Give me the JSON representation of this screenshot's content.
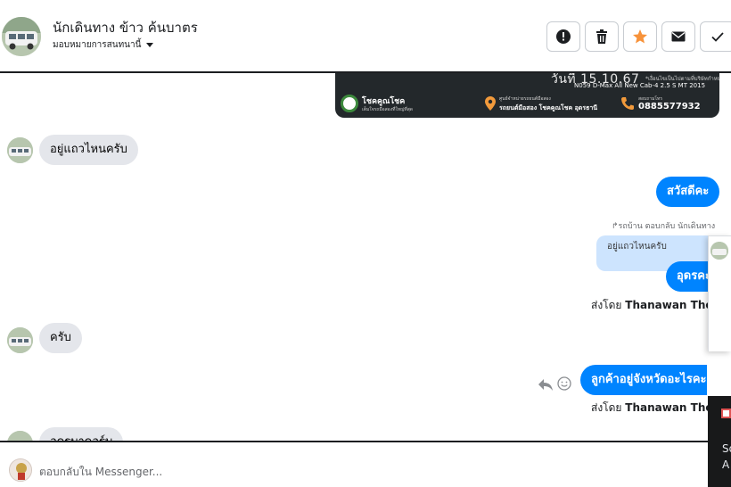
{
  "header": {
    "contact_name": "นักเดินทาง ข้าว ค้นบาตร",
    "assign_label": "มอบหมายการสนทนานี้",
    "actions": [
      {
        "name": "report-button",
        "icon": "alert-icon"
      },
      {
        "name": "delete-button",
        "icon": "trash-icon"
      },
      {
        "name": "star-button",
        "icon": "star-icon"
      },
      {
        "name": "mark-unread-button",
        "icon": "envelope-icon"
      },
      {
        "name": "mark-done-button",
        "icon": "check-icon"
      }
    ]
  },
  "banner": {
    "date": "วันที่ 15.10.67",
    "note": "*เงื่อนไขเป็นไปตามที่บริษัทกำหนด",
    "model": "N059 D-Max All New Cab-4 2.5 S MT 2015",
    "brand": "โชคคูณโชค",
    "brand_sub": "เต็มใจรถมือสองที่ใหญ่ที่สุด",
    "address_title": "ศูนย์จำหน่ายรถยนต์มือสอง",
    "address": "รถยนต์มือสอง โชคคูณโชค อุดรธานี",
    "phone_title": "สอบถามโทร",
    "phone": "0885577932"
  },
  "messages": [
    {
      "dir": "in",
      "text": "อยู่แถวไหนครับ"
    },
    {
      "dir": "out",
      "text": "สวัสดีคะ"
    },
    {
      "dir": "reply_label",
      "text": "รถบ้าน ตอบกลับ นักเดินทาง"
    },
    {
      "dir": "quote",
      "text": "อยู่แถวไหนครับ"
    },
    {
      "dir": "out",
      "text": "อุดรคะ"
    },
    {
      "dir": "sent_by",
      "prefix": "ส่งโดย",
      "name": "Thanawan Thon"
    },
    {
      "dir": "in",
      "text": "ครับ"
    },
    {
      "dir": "out",
      "text": "ลูกค้าอยู่จังหวัดอะไรคะ"
    },
    {
      "dir": "sent_by",
      "prefix": "ส่งโดย",
      "name": "Thanawan Thon"
    },
    {
      "dir": "in",
      "text": "อุดรบาดอร์บ"
    }
  ],
  "side_widget": {
    "text_1": "So",
    "text_2": "A"
  },
  "footer": {
    "placeholder": "ตอบกลับใน Messenger..."
  },
  "colors": {
    "accent_blue": "#0084ff",
    "incoming_bubble": "#e4e6eb",
    "star": "#f7923a",
    "quote_bg": "#cde4fe"
  }
}
